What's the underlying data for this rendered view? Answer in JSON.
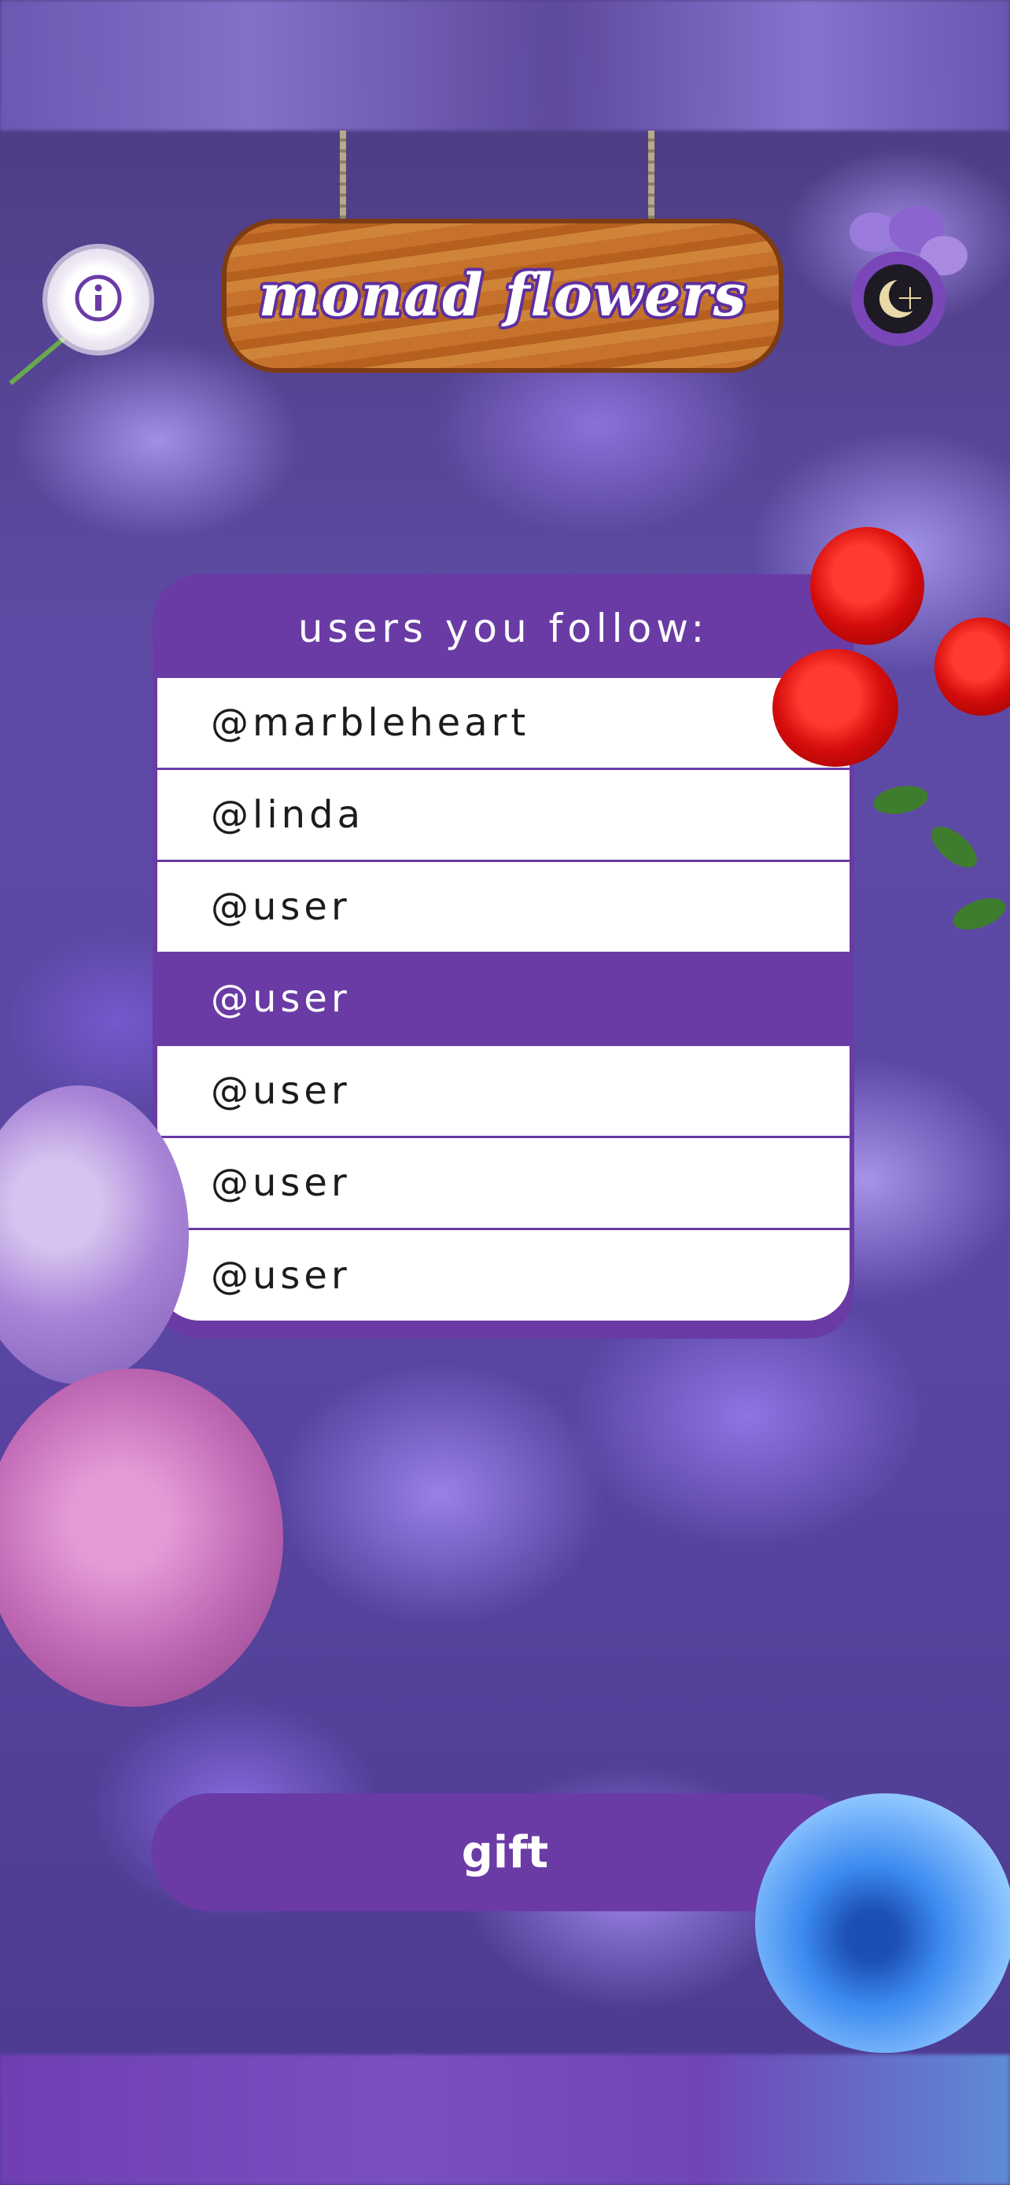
{
  "header": {
    "title": "monad flowers",
    "info_icon": "info-icon",
    "moon_icon": "moon-sun-icon"
  },
  "follow_list": {
    "title": "users you follow:",
    "users": [
      {
        "handle": "@marbleheart"
      },
      {
        "handle": "@linda"
      },
      {
        "handle": "@user"
      },
      {
        "handle": "@user",
        "selected": true
      },
      {
        "handle": "@user"
      },
      {
        "handle": "@user"
      },
      {
        "handle": "@user"
      }
    ]
  },
  "gift_button": {
    "label": "gift"
  },
  "colors": {
    "accent_purple": "#6a3ba5",
    "sign_wood": "#c6722c",
    "row_bg": "#ffffff"
  }
}
